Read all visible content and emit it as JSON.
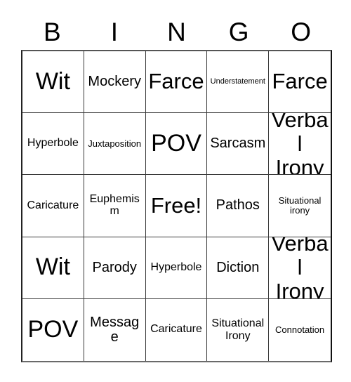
{
  "card": {
    "header_letters": [
      "B",
      "I",
      "N",
      "G",
      "O"
    ],
    "grid_size": 5,
    "free_space_label": "Free!",
    "free_space_position": {
      "row": 3,
      "col": 3
    },
    "border_color": "#3a3a3a",
    "background_color": "#ffffff",
    "text_color": "#000000",
    "rows": [
      [
        {
          "label": "Wit",
          "size": "s-xl"
        },
        {
          "label": "Mockery",
          "size": "s-md"
        },
        {
          "label": "Farce",
          "size": "s-lg"
        },
        {
          "label": "Understatement",
          "size": "s-xxs"
        },
        {
          "label": "Farce",
          "size": "s-lg"
        }
      ],
      [
        {
          "label": "Hyperbole",
          "size": "s-sm"
        },
        {
          "label": "Juxtaposition",
          "size": "s-xs"
        },
        {
          "label": "POV",
          "size": "s-xl"
        },
        {
          "label": "Sarcasm",
          "size": "s-md"
        },
        {
          "label": "Verbal Irony",
          "size": "s-lg two-line"
        }
      ],
      [
        {
          "label": "Caricature",
          "size": "s-sm"
        },
        {
          "label": "Euphemism",
          "size": "s-sm"
        },
        {
          "label": "Free!",
          "size": "s-lg"
        },
        {
          "label": "Pathos",
          "size": "s-md"
        },
        {
          "label": "Situational irony",
          "size": "s-xs two-line"
        }
      ],
      [
        {
          "label": "Wit",
          "size": "s-xl"
        },
        {
          "label": "Parody",
          "size": "s-md"
        },
        {
          "label": "Hyperbole",
          "size": "s-sm"
        },
        {
          "label": "Diction",
          "size": "s-md"
        },
        {
          "label": "Verbal Irony",
          "size": "s-lg two-line"
        }
      ],
      [
        {
          "label": "POV",
          "size": "s-xl"
        },
        {
          "label": "Message",
          "size": "s-md"
        },
        {
          "label": "Caricature",
          "size": "s-sm"
        },
        {
          "label": "Situational Irony",
          "size": "s-sm two-line"
        },
        {
          "label": "Connotation",
          "size": "s-xs"
        }
      ]
    ]
  }
}
